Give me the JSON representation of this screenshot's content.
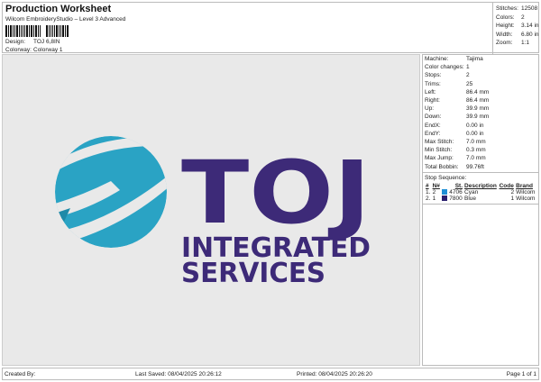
{
  "header": {
    "title": "Production Worksheet",
    "subtitle": "Wilcom EmbroideryStudio – Level 3 Advanced",
    "design_label": "Design:",
    "design_value": "TOJ 6,8IN",
    "colorway_label": "Colorway:",
    "colorway_value": "Colorway 1"
  },
  "stats": [
    {
      "k": "Stitches:",
      "v": "12508"
    },
    {
      "k": "Colors:",
      "v": "2"
    },
    {
      "k": "Height:",
      "v": "3.14 in"
    },
    {
      "k": "Width:",
      "v": "6.80 in"
    },
    {
      "k": "Zoom:",
      "v": "1:1"
    }
  ],
  "design": {
    "logo_title": "TOJ",
    "logo_line1": "INTEGRATED",
    "logo_line2": "SERVICES",
    "colors": {
      "cyan": "#2aa3c4",
      "purple": "#3d2a78"
    }
  },
  "properties": [
    {
      "k": "Machine:",
      "v": "Tajima"
    },
    {
      "k": "Color changes:",
      "v": "1"
    },
    {
      "k": "Stops:",
      "v": "2"
    },
    {
      "k": "Trims:",
      "v": "25"
    },
    {
      "k": "Left:",
      "v": "86.4 mm"
    },
    {
      "k": "Right:",
      "v": "86.4 mm"
    },
    {
      "k": "Up:",
      "v": "39.9 mm"
    },
    {
      "k": "Down:",
      "v": "39.9 mm"
    },
    {
      "k": "EndX:",
      "v": "0.00 in"
    },
    {
      "k": "EndY:",
      "v": "0.00 in"
    },
    {
      "k": "Max Stitch:",
      "v": "7.0 mm"
    },
    {
      "k": "Min Stitch:",
      "v": "0.3 mm"
    },
    {
      "k": "Max Jump:",
      "v": "7.0 mm"
    },
    {
      "k": "Total Bobbin:",
      "v": "99.76ft"
    }
  ],
  "stop_sequence": {
    "title": "Stop Sequence:",
    "headers": [
      "#",
      "N#",
      "St.",
      "Description",
      "Code",
      "Brand"
    ],
    "rows": [
      {
        "num": "1.",
        "n": "2",
        "color": "#1e8fd6",
        "st": "4706",
        "desc": "Cyan",
        "code": "2",
        "brand": "Wilcom"
      },
      {
        "num": "2.",
        "n": "1",
        "color": "#2a1f6e",
        "st": "7800",
        "desc": "Blue",
        "code": "1",
        "brand": "Wilcom"
      }
    ]
  },
  "footer": {
    "created_by": "Created By:",
    "last_saved": "Last Saved: 08/04/2025 20:26:12",
    "printed": "Printed: 08/04/2025 20:26:20",
    "page": "Page 1 of 1"
  }
}
